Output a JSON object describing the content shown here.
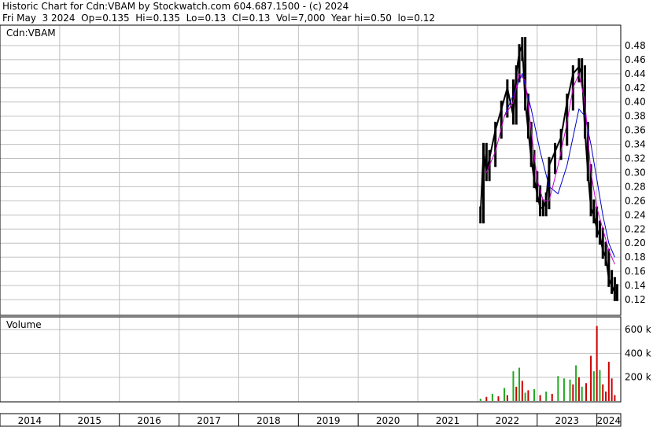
{
  "header": {
    "line1": "Historic Chart for Cdn:VBAM by Stockwatch.com 604.687.1500 - (c) 2024",
    "line2": "Fri May  3 2024  Op=0.135  Hi=0.135  Lo=0.13  Cl=0.13  Vol=7,000  Year hi=0.50  lo=0.12"
  },
  "colors": {
    "price_bar": "#000000",
    "ma_short": "#cc00cc",
    "ma_long": "#0000cc",
    "vol_up": "#22aa22",
    "vol_down": "#cc0000",
    "grid": "#c0c0c0"
  },
  "chart_data": [
    {
      "type": "line",
      "title": "Cdn:VBAM",
      "ylim": [
        0.11,
        0.5
      ],
      "y_ticks": [
        "0.48",
        "0.46",
        "0.44",
        "0.42",
        "0.40",
        "0.38",
        "0.36",
        "0.34",
        "0.32",
        "0.30",
        "0.28",
        "0.26",
        "0.24",
        "0.22",
        "0.20",
        "0.18",
        "0.16",
        "0.14",
        "0.12"
      ],
      "x_ticks": [
        "2014",
        "2015",
        "2016",
        "2017",
        "2018",
        "2019",
        "2020",
        "2021",
        "2022",
        "2023",
        "2024"
      ],
      "series": [
        {
          "role": "price",
          "x": [
            2022.05,
            2022.1,
            2022.15,
            2022.2,
            2022.3,
            2022.4,
            2022.5,
            2022.6,
            2022.65,
            2022.7,
            2022.75,
            2022.8,
            2022.85,
            2022.9,
            2022.95,
            2023.0,
            2023.05,
            2023.1,
            2023.15,
            2023.2,
            2023.3,
            2023.4,
            2023.5,
            2023.6,
            2023.7,
            2023.75,
            2023.8,
            2023.85,
            2023.9,
            2023.95,
            2024.0,
            2024.05,
            2024.1,
            2024.15,
            2024.2,
            2024.25,
            2024.3,
            2024.34
          ],
          "y": [
            0.24,
            0.33,
            0.3,
            0.32,
            0.36,
            0.39,
            0.42,
            0.38,
            0.44,
            0.47,
            0.48,
            0.4,
            0.36,
            0.32,
            0.29,
            0.27,
            0.25,
            0.25,
            0.26,
            0.31,
            0.33,
            0.35,
            0.4,
            0.44,
            0.45,
            0.44,
            0.36,
            0.3,
            0.25,
            0.24,
            0.22,
            0.21,
            0.19,
            0.18,
            0.15,
            0.14,
            0.13,
            0.13
          ]
        },
        {
          "role": "ma_short",
          "x": [
            2022.15,
            2022.3,
            2022.45,
            2022.6,
            2022.7,
            2022.8,
            2022.9,
            2023.0,
            2023.1,
            2023.2,
            2023.35,
            2023.5,
            2023.6,
            2023.7,
            2023.8,
            2023.9,
            2024.0,
            2024.1,
            2024.2,
            2024.3
          ],
          "y": [
            0.3,
            0.33,
            0.38,
            0.4,
            0.44,
            0.43,
            0.36,
            0.29,
            0.26,
            0.26,
            0.31,
            0.37,
            0.42,
            0.44,
            0.4,
            0.3,
            0.25,
            0.22,
            0.19,
            0.17
          ]
        },
        {
          "role": "ma_long",
          "x": [
            2022.45,
            2022.6,
            2022.75,
            2022.9,
            2023.05,
            2023.2,
            2023.35,
            2023.5,
            2023.6,
            2023.7,
            2023.8,
            2023.9,
            2024.0,
            2024.1,
            2024.2,
            2024.3
          ],
          "y": [
            0.38,
            0.41,
            0.44,
            0.39,
            0.33,
            0.28,
            0.27,
            0.31,
            0.35,
            0.39,
            0.38,
            0.34,
            0.29,
            0.24,
            0.2,
            0.18
          ]
        }
      ]
    },
    {
      "type": "bar",
      "title": "Volume",
      "ylim": [
        0,
        700000
      ],
      "y_ticks": [
        "600 k",
        "400 k",
        "200 k"
      ],
      "bars": [
        {
          "x": 2022.05,
          "v": 20000,
          "up": true
        },
        {
          "x": 2022.15,
          "v": 35000,
          "up": false
        },
        {
          "x": 2022.25,
          "v": 60000,
          "up": true
        },
        {
          "x": 2022.35,
          "v": 40000,
          "up": false
        },
        {
          "x": 2022.45,
          "v": 110000,
          "up": true
        },
        {
          "x": 2022.5,
          "v": 50000,
          "up": false
        },
        {
          "x": 2022.6,
          "v": 250000,
          "up": true
        },
        {
          "x": 2022.65,
          "v": 120000,
          "up": false
        },
        {
          "x": 2022.7,
          "v": 280000,
          "up": true
        },
        {
          "x": 2022.75,
          "v": 170000,
          "up": false
        },
        {
          "x": 2022.8,
          "v": 70000,
          "up": true
        },
        {
          "x": 2022.85,
          "v": 90000,
          "up": false
        },
        {
          "x": 2022.95,
          "v": 100000,
          "up": true
        },
        {
          "x": 2023.05,
          "v": 50000,
          "up": false
        },
        {
          "x": 2023.15,
          "v": 80000,
          "up": true
        },
        {
          "x": 2023.25,
          "v": 60000,
          "up": false
        },
        {
          "x": 2023.35,
          "v": 210000,
          "up": true
        },
        {
          "x": 2023.45,
          "v": 190000,
          "up": true
        },
        {
          "x": 2023.55,
          "v": 180000,
          "up": true
        },
        {
          "x": 2023.6,
          "v": 140000,
          "up": false
        },
        {
          "x": 2023.65,
          "v": 300000,
          "up": true
        },
        {
          "x": 2023.7,
          "v": 200000,
          "up": false
        },
        {
          "x": 2023.75,
          "v": 120000,
          "up": true
        },
        {
          "x": 2023.82,
          "v": 150000,
          "up": false
        },
        {
          "x": 2023.9,
          "v": 380000,
          "up": false
        },
        {
          "x": 2023.95,
          "v": 250000,
          "up": true
        },
        {
          "x": 2024.0,
          "v": 630000,
          "up": false
        },
        {
          "x": 2024.05,
          "v": 260000,
          "up": true
        },
        {
          "x": 2024.1,
          "v": 140000,
          "up": false
        },
        {
          "x": 2024.15,
          "v": 80000,
          "up": false
        },
        {
          "x": 2024.2,
          "v": 330000,
          "up": false
        },
        {
          "x": 2024.25,
          "v": 190000,
          "up": false
        },
        {
          "x": 2024.3,
          "v": 50000,
          "up": false
        }
      ]
    }
  ]
}
